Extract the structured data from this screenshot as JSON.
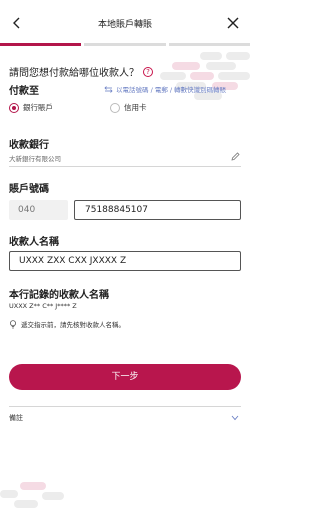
{
  "header": {
    "title": "本地賬戶轉賬"
  },
  "progress": {
    "total_steps": 3,
    "current_step": 1
  },
  "question": {
    "text": "請問您想付款給哪位收款人？"
  },
  "pay_to": {
    "label": "付款至",
    "swap_link": "以電話號碼 / 電郵 / 轉數快識別碼轉賬",
    "options": [
      {
        "label": "銀行賬戶",
        "selected": true
      },
      {
        "label": "信用卡",
        "selected": false
      }
    ]
  },
  "receiving_bank": {
    "label": "收款銀行",
    "value": "大新銀行有限公司"
  },
  "account_number": {
    "label": "賬戶號碼",
    "prefix": "040",
    "value": "75188845107"
  },
  "payee_name": {
    "label": "收款人名稱",
    "value": "UXXX ZXX CXX JXXXX Z"
  },
  "recorded_name": {
    "label": "本行記錄的收款人名稱",
    "value": "UXXX Z** C** J**** Z",
    "tip": "遞交指示前，請先核對收款人名稱。"
  },
  "actions": {
    "next_label": "下一步"
  },
  "remarks": {
    "label": "備註"
  },
  "colors": {
    "brand": "#b8164d",
    "link": "#6a7fc4"
  }
}
